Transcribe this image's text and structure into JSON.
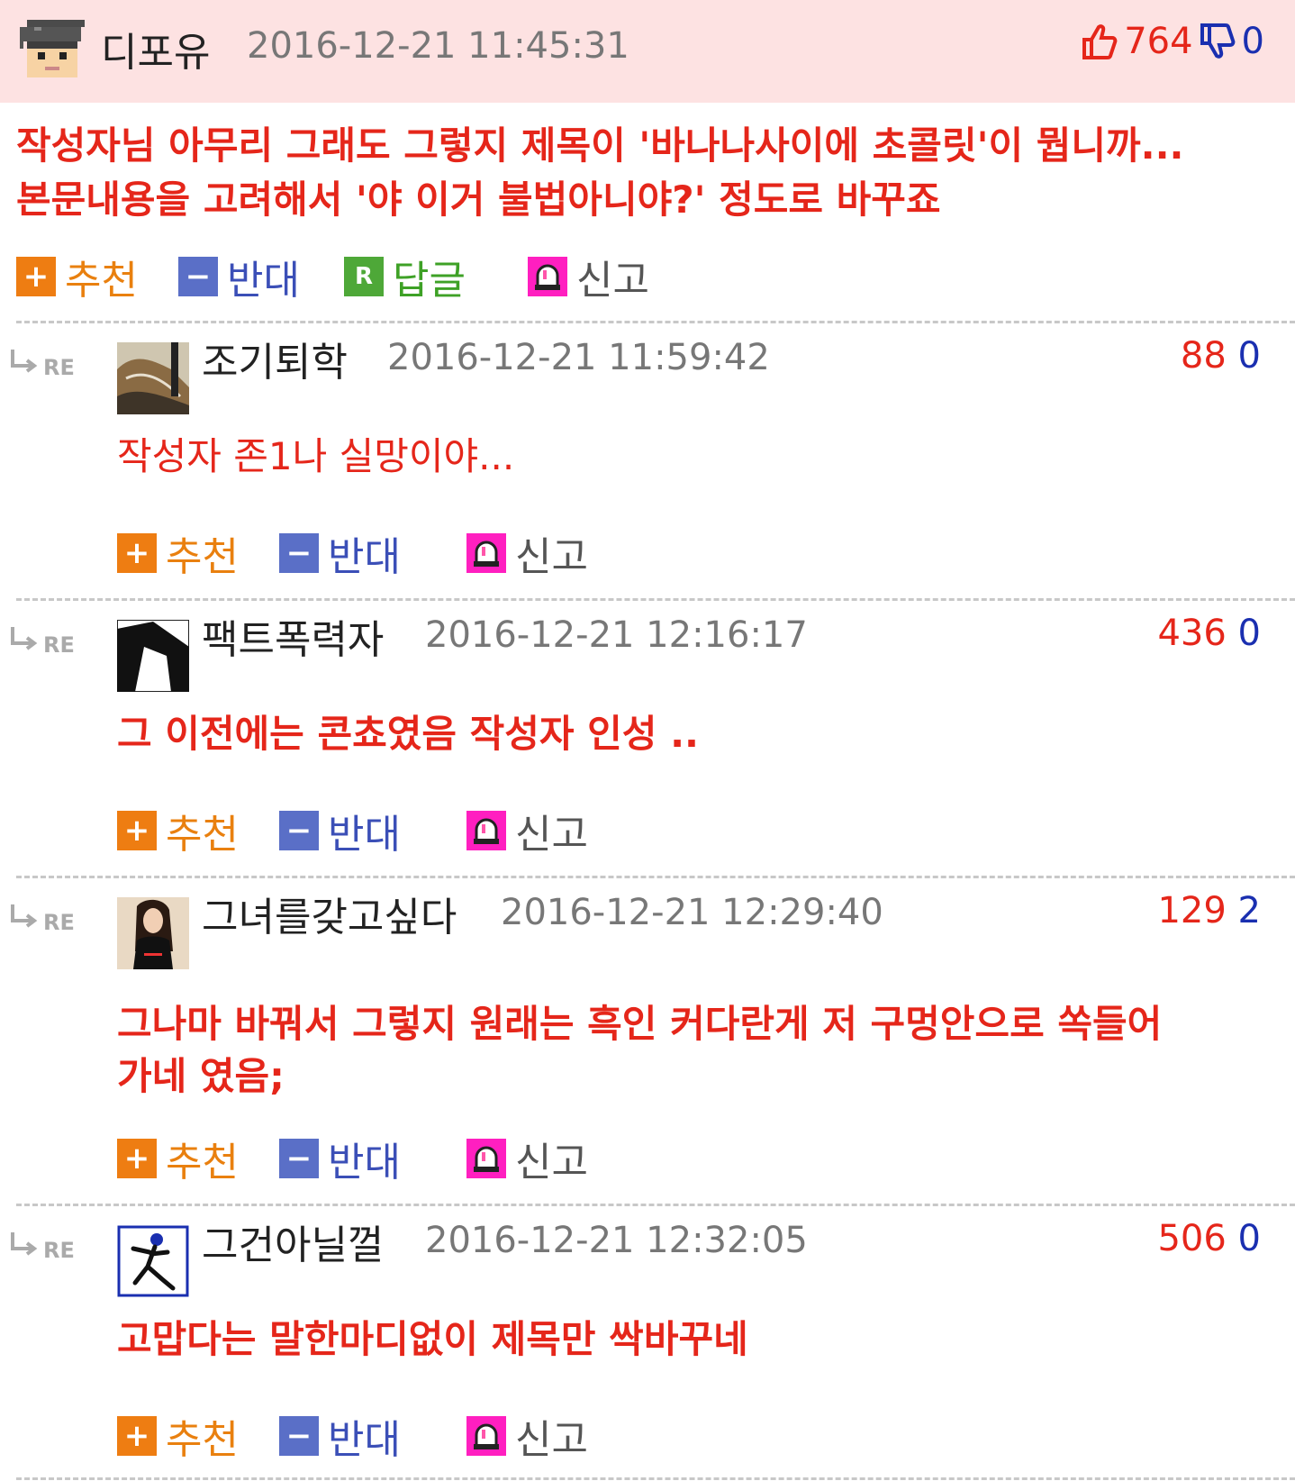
{
  "best": {
    "nickname": "디포유",
    "datetime": "2016-12-21 11:45:31",
    "up": "764",
    "down": "0",
    "body_lines": [
      "작성자님 아무리 그래도 그렇지 제목이 '바나나사이에 초콜릿'이 뭡니까...",
      "본문내용을 고려해서 '야 이거 불법아니야?' 정도로 바꾸죠"
    ]
  },
  "labels": {
    "recommend": "추천",
    "oppose": "반대",
    "reply": "답글",
    "report": "신고",
    "reply_mark": "RE",
    "reply_icon_letter": "R"
  },
  "replies": [
    {
      "nickname": "조기퇴학",
      "datetime": "2016-12-21 11:59:42",
      "up": "88",
      "down": "0",
      "body_lines": [
        "작성자 존1나 실망이야..."
      ]
    },
    {
      "nickname": "팩트폭력자",
      "datetime": "2016-12-21 12:16:17",
      "up": "436",
      "down": "0",
      "body_lines": [
        "그 이전에는 콘쵸였음 작성자 인성 .."
      ]
    },
    {
      "nickname": "그녀를갖고싶다",
      "datetime": "2016-12-21 12:29:40",
      "up": "129",
      "down": "2",
      "body_lines": [
        "그나마 바꿔서 그렇지 원래는 흑인 커다란게 저 구멍안으로 쏙들어",
        "가네 였음;"
      ]
    },
    {
      "nickname": "그건아닐껄",
      "datetime": "2016-12-21 12:32:05",
      "up": "506",
      "down": "0",
      "body_lines": [
        "고맙다는 말한마디없이 제목만 싹바꾸네"
      ]
    }
  ],
  "colors": {
    "best_bg": "#fde2e2",
    "up": "#e5261a",
    "down": "#1a2fb0",
    "recommend": "#e9800f",
    "oppose": "#3b4fb7",
    "reply": "#3ea126",
    "report_icon": "#ff1fc0"
  },
  "icons": {
    "thumb_up": "thumbs-up-icon",
    "thumb_down": "thumbs-down-icon",
    "plus": "plus-icon",
    "minus": "minus-icon",
    "reply": "reply-icon",
    "report": "siren-icon",
    "reply_arrow": "reply-arrow-icon"
  }
}
